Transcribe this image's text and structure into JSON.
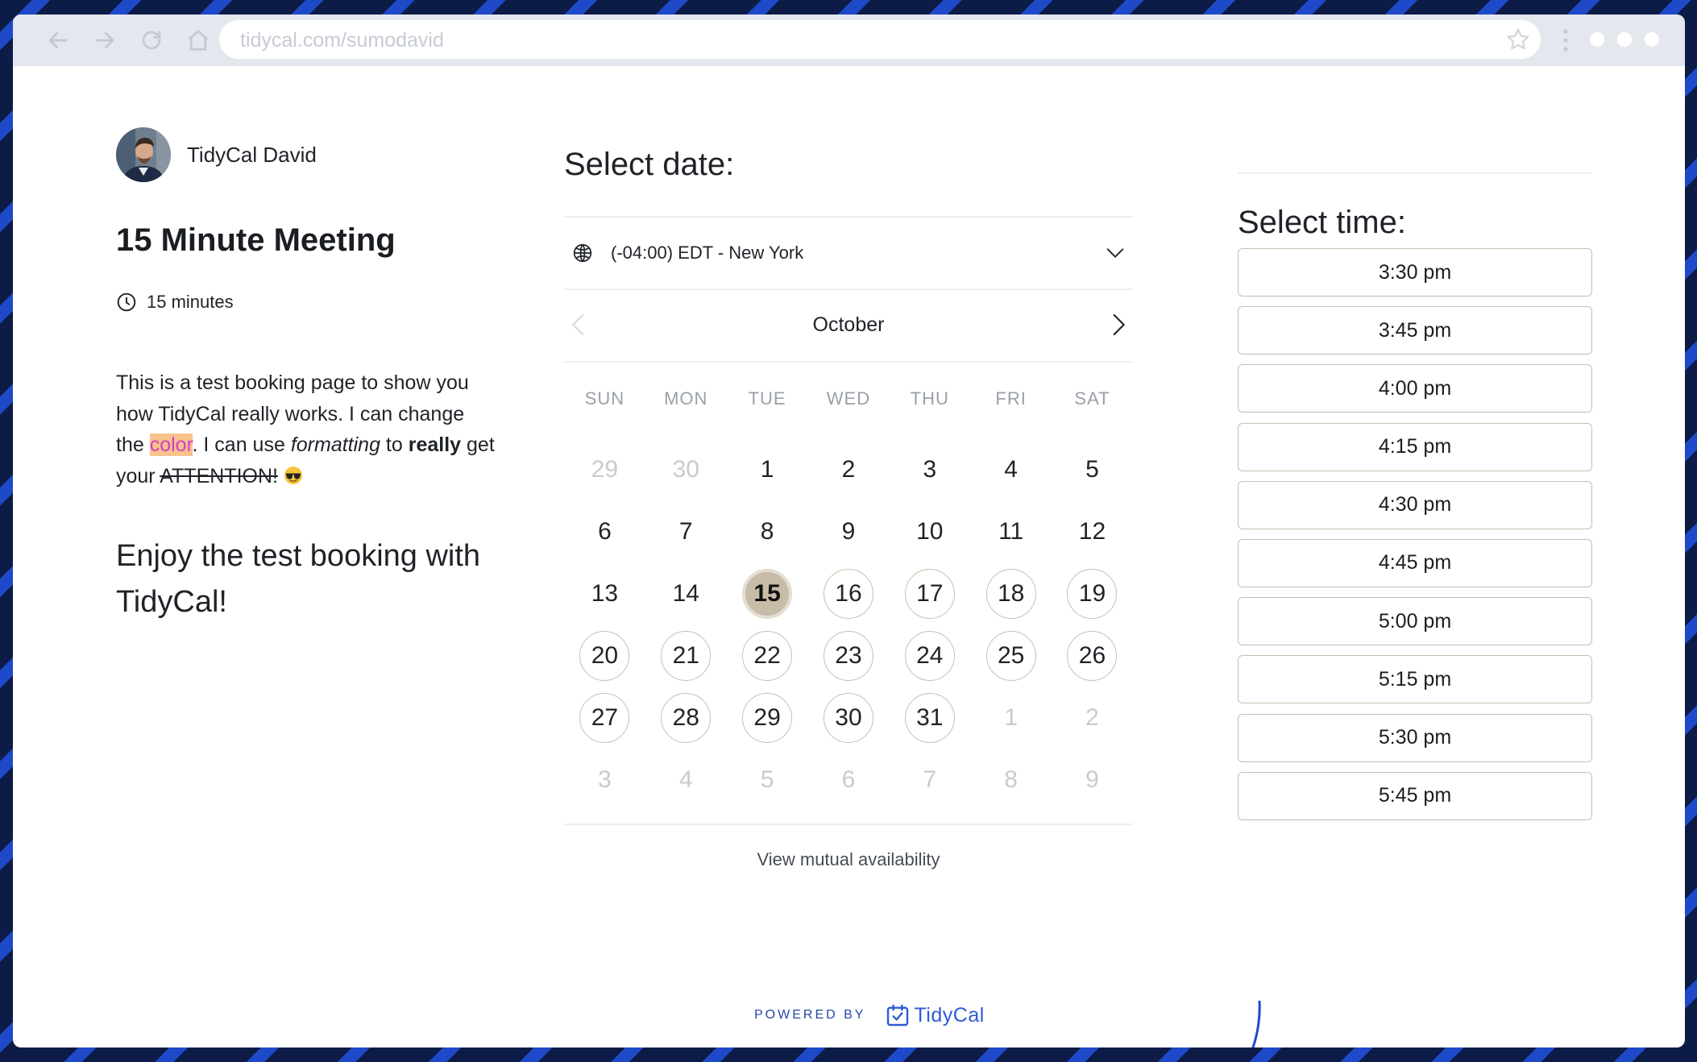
{
  "browser": {
    "url": "tidycal.com/sumodavid"
  },
  "host": {
    "name": "TidyCal David"
  },
  "meeting": {
    "title": "15 Minute Meeting",
    "duration": "15 minutes",
    "description": {
      "part1": "This is a test booking page to show you how TidyCal really works. I can change the ",
      "highlight": "color",
      "part2": ". I can use ",
      "italic": "formatting",
      "part3": " to ",
      "bold": "really",
      "part4": " get your ",
      "strike": "ATTENTION!",
      "emoji": "sunglasses-emoji"
    },
    "tagline": "Enjoy the test booking with TidyCal!"
  },
  "calendar": {
    "heading": "Select date:",
    "timezone": "(-04:00) EDT - New York",
    "month": "October",
    "weekdays": [
      "SUN",
      "MON",
      "TUE",
      "WED",
      "THU",
      "FRI",
      "SAT"
    ],
    "weeks": [
      [
        {
          "d": "29",
          "s": "muted"
        },
        {
          "d": "30",
          "s": "muted"
        },
        {
          "d": "1",
          "s": "plain"
        },
        {
          "d": "2",
          "s": "plain"
        },
        {
          "d": "3",
          "s": "plain"
        },
        {
          "d": "4",
          "s": "plain"
        },
        {
          "d": "5",
          "s": "plain"
        }
      ],
      [
        {
          "d": "6",
          "s": "plain"
        },
        {
          "d": "7",
          "s": "plain"
        },
        {
          "d": "8",
          "s": "plain"
        },
        {
          "d": "9",
          "s": "plain"
        },
        {
          "d": "10",
          "s": "plain"
        },
        {
          "d": "11",
          "s": "plain"
        },
        {
          "d": "12",
          "s": "plain"
        }
      ],
      [
        {
          "d": "13",
          "s": "plain"
        },
        {
          "d": "14",
          "s": "plain"
        },
        {
          "d": "15",
          "s": "selected"
        },
        {
          "d": "16",
          "s": "avail"
        },
        {
          "d": "17",
          "s": "avail"
        },
        {
          "d": "18",
          "s": "avail"
        },
        {
          "d": "19",
          "s": "avail"
        }
      ],
      [
        {
          "d": "20",
          "s": "avail"
        },
        {
          "d": "21",
          "s": "avail"
        },
        {
          "d": "22",
          "s": "avail"
        },
        {
          "d": "23",
          "s": "avail"
        },
        {
          "d": "24",
          "s": "avail"
        },
        {
          "d": "25",
          "s": "avail"
        },
        {
          "d": "26",
          "s": "avail"
        }
      ],
      [
        {
          "d": "27",
          "s": "avail"
        },
        {
          "d": "28",
          "s": "avail"
        },
        {
          "d": "29",
          "s": "avail"
        },
        {
          "d": "30",
          "s": "avail"
        },
        {
          "d": "31",
          "s": "avail"
        },
        {
          "d": "1",
          "s": "muted"
        },
        {
          "d": "2",
          "s": "muted"
        }
      ],
      [
        {
          "d": "3",
          "s": "muted"
        },
        {
          "d": "4",
          "s": "muted"
        },
        {
          "d": "5",
          "s": "muted"
        },
        {
          "d": "6",
          "s": "muted"
        },
        {
          "d": "7",
          "s": "muted"
        },
        {
          "d": "8",
          "s": "muted"
        },
        {
          "d": "9",
          "s": "muted"
        }
      ]
    ],
    "mutual_link": "View mutual availability"
  },
  "times": {
    "heading": "Select time:",
    "slots": [
      "3:30 pm",
      "3:45 pm",
      "4:00 pm",
      "4:15 pm",
      "4:30 pm",
      "4:45 pm",
      "5:00 pm",
      "5:15 pm",
      "5:30 pm",
      "5:45 pm"
    ]
  },
  "footer": {
    "powered_by": "POWERED BY",
    "brand": "TidyCal"
  },
  "colors": {
    "accent_border": "#c8bfae",
    "selected_day": "#c7bca8",
    "brand_blue": "#2e5ad6",
    "highlight_bg": "#f7c28b",
    "highlight_text": "#d33fc9"
  }
}
